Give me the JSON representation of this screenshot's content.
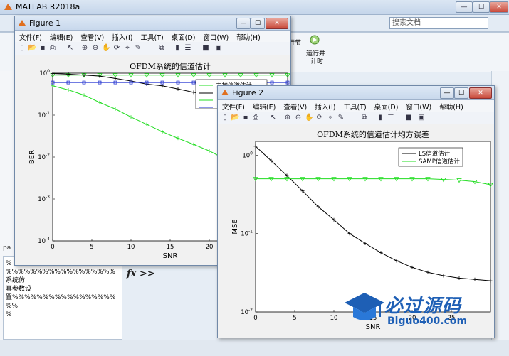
{
  "main": {
    "title": "MATLAB R2018a",
    "search_placeholder": "搜索文档",
    "ribbon_label_1": "行节",
    "ribbon_label_2": "运行并",
    "ribbon_label_3": "计时",
    "cmd_lines": [
      "%",
      "%%%%%%%%%%%%%%%%%%系统仿",
      "真参数设",
      "置%%%%%%%%%%%%%%%%%%%",
      "%"
    ],
    "pa_label": "pa",
    "prompt": "fx >>"
  },
  "fig1": {
    "title": "Figure 1",
    "menu": [
      "文件(F)",
      "编辑(E)",
      "查看(V)",
      "插入(I)",
      "工具(T)",
      "桌面(D)",
      "窗口(W)",
      "帮助(H)"
    ]
  },
  "fig2": {
    "title": "Figure 2",
    "menu": [
      "文件(F)",
      "编辑(E)",
      "查看(V)",
      "插入(I)",
      "工具(T)",
      "桌面(D)",
      "窗口(W)",
      "帮助(H)"
    ]
  },
  "watermark": {
    "cn": "必过源码",
    "en": "Biguo400.com"
  },
  "colors": {
    "black_series": "#000000",
    "green_series": "#22dd22",
    "blue_series": "#1f2fd0"
  },
  "chart_data": [
    {
      "type": "line",
      "title": "OFDM系统的信道估计",
      "xlabel": "SNR",
      "ylabel": "BER",
      "xlim": [
        0,
        30
      ],
      "ylim": [
        0.0001,
        1
      ],
      "yscale": "log",
      "xticks": [
        0,
        5,
        10,
        15,
        20,
        25
      ],
      "yticks_labels": [
        "10^0",
        "10^-1",
        "10^-2",
        "10^-3",
        "10^-4"
      ],
      "legend_entries": [
        "未加信道估计"
      ],
      "x": [
        0,
        2,
        4,
        6,
        8,
        10,
        12,
        14,
        16,
        18,
        20,
        22,
        24,
        26,
        28,
        30
      ],
      "series": [
        {
          "name": "未加信道估计",
          "marker": "triangle-down",
          "values": [
            0.9,
            0.9,
            0.9,
            0.9,
            0.9,
            0.9,
            0.9,
            0.9,
            0.9,
            0.9,
            0.9,
            0.9,
            0.9,
            0.9,
            0.9,
            0.9
          ]
        },
        {
          "values": [
            0.98,
            0.95,
            0.9,
            0.85,
            0.75,
            0.65,
            0.55,
            0.5,
            0.42,
            0.35,
            0.3,
            0.28,
            0.26,
            0.25,
            0.24,
            0.24
          ]
        },
        {
          "values": [
            0.5,
            0.4,
            0.3,
            0.2,
            0.14,
            0.09,
            0.06,
            0.04,
            0.028,
            0.02,
            0.014,
            0.009,
            0.006,
            0.004,
            0.0025,
            0.0018
          ]
        },
        {
          "values": [
            0.6,
            0.6,
            0.6,
            0.6,
            0.6,
            0.6,
            0.6,
            0.6,
            0.6,
            0.6,
            0.6,
            0.6,
            0.6,
            0.6,
            0.6,
            0.6
          ]
        }
      ]
    },
    {
      "type": "line",
      "title": "OFDM系统的信道估计均方误差",
      "xlabel": "SNR",
      "ylabel": "MSE",
      "xlim": [
        0,
        30
      ],
      "ylim": [
        0.01,
        1.5
      ],
      "yscale": "log",
      "xticks": [
        0,
        5,
        10,
        15,
        20,
        25
      ],
      "yticks_labels": [
        "10^0",
        "10^-1",
        "10^-2"
      ],
      "legend_entries": [
        "LS信道估计",
        "SAMP信道估计"
      ],
      "x": [
        0,
        2,
        4,
        6,
        8,
        10,
        12,
        14,
        16,
        18,
        20,
        22,
        24,
        26,
        28,
        30
      ],
      "series": [
        {
          "name": "LS信道估计",
          "marker": "plus",
          "values": [
            1.3,
            0.85,
            0.55,
            0.35,
            0.22,
            0.15,
            0.1,
            0.075,
            0.057,
            0.045,
            0.037,
            0.032,
            0.029,
            0.027,
            0.026,
            0.025
          ]
        },
        {
          "name": "SAMP信道估计",
          "marker": "triangle-down",
          "values": [
            0.5,
            0.5,
            0.5,
            0.5,
            0.5,
            0.5,
            0.5,
            0.5,
            0.5,
            0.5,
            0.5,
            0.5,
            0.49,
            0.48,
            0.46,
            0.42
          ]
        }
      ]
    }
  ]
}
